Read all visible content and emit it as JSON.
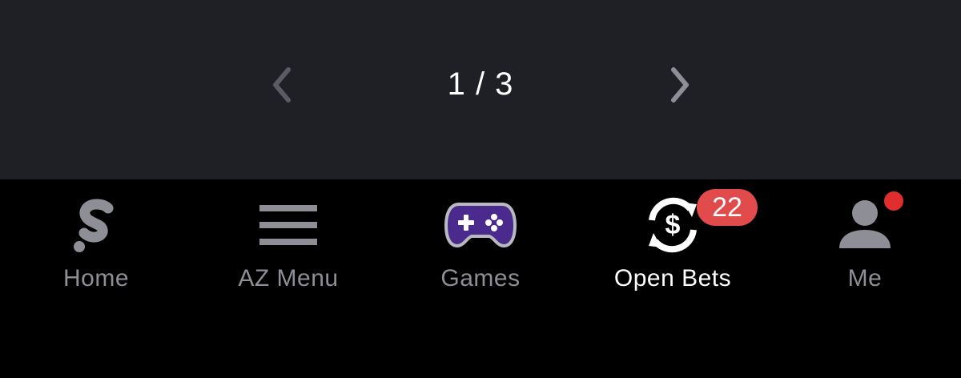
{
  "pager": {
    "current": "1",
    "separator": "/",
    "total": "3",
    "label": "1 / 3",
    "prev_icon": "chevron-left-icon",
    "next_icon": "chevron-right-icon"
  },
  "tabbar": {
    "tabs": [
      {
        "id": "home",
        "label": "Home",
        "icon": "brand-s-icon",
        "active": false
      },
      {
        "id": "az-menu",
        "label": "AZ Menu",
        "icon": "hamburger-menu-icon",
        "active": false
      },
      {
        "id": "games",
        "label": "Games",
        "icon": "gamepad-icon",
        "active": false
      },
      {
        "id": "open-bets",
        "label": "Open Bets",
        "icon": "dollar-refresh-icon",
        "active": true,
        "badge": "22"
      },
      {
        "id": "me",
        "label": "Me",
        "icon": "person-icon",
        "active": false,
        "notification_dot": true
      }
    ]
  },
  "colors": {
    "pager_background": "#1f2026",
    "tabbar_background": "#000000",
    "muted_text": "#8e8f96",
    "active_text": "#ffffff",
    "badge": "#e14b4b",
    "gamepad": "#4a2a8c",
    "notification_dot": "#e02e2e"
  }
}
